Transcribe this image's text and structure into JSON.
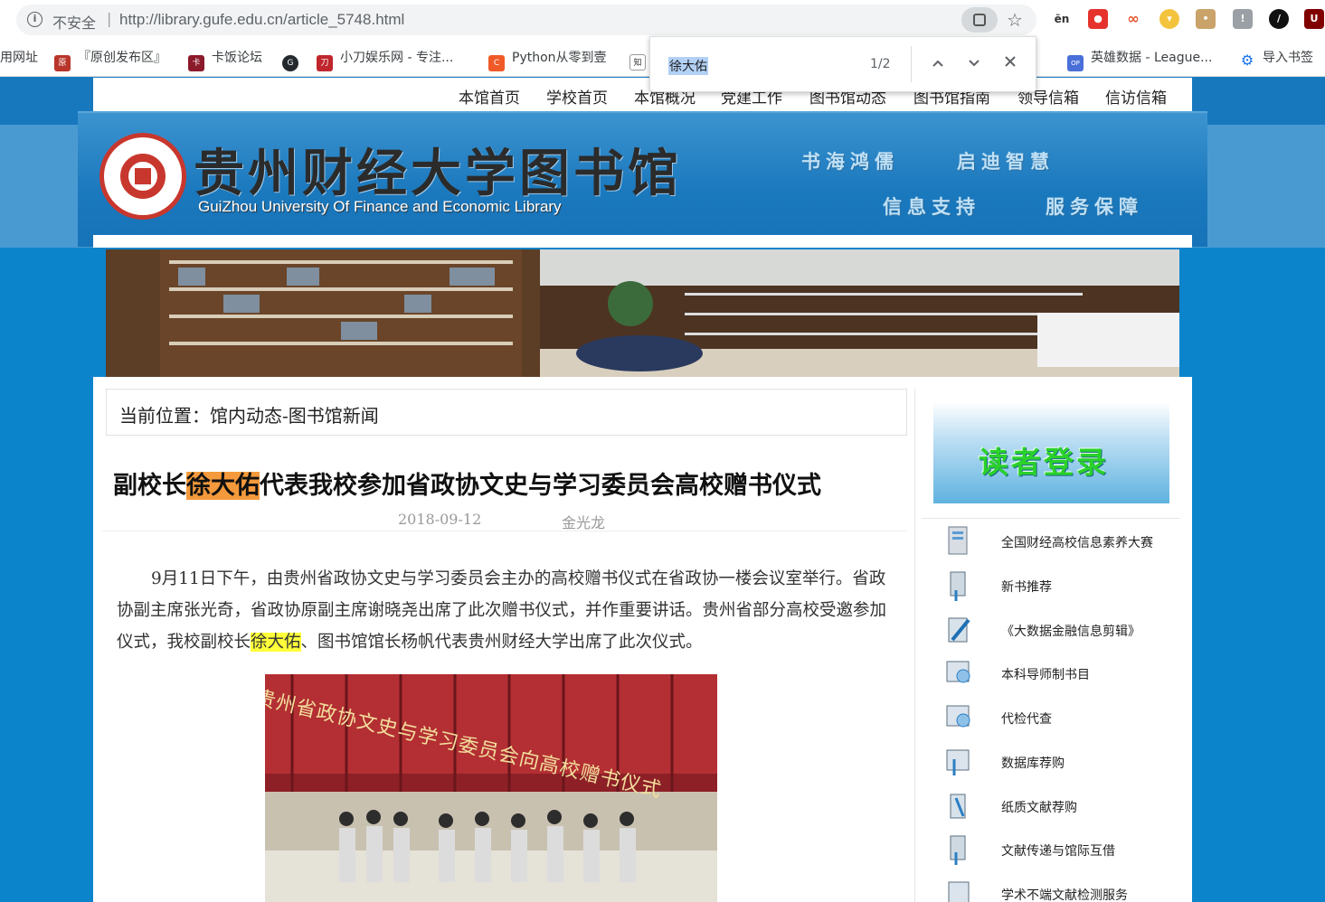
{
  "browser": {
    "security_label": "不安全",
    "url": "http://library.gufe.edu.cn/article_5748.html",
    "find": {
      "query": "徐大佑",
      "count": "1/2"
    },
    "bookmarks": [
      {
        "label": "用网址",
        "icon": "bookmark-icon"
      },
      {
        "label": "『原创发布区』",
        "icon": "site-icon"
      },
      {
        "label": "卡饭论坛",
        "icon": "kafan-icon"
      },
      {
        "label": "",
        "icon": "github-icon"
      },
      {
        "label": "小刀娱乐网 - 专注...",
        "icon": "xiaodao-icon"
      },
      {
        "label": "Python从零到壹",
        "icon": "csdn-icon"
      },
      {
        "label": "",
        "icon": "zhihu-icon"
      },
      {
        "label": "英雄数据 - League...",
        "icon": "opgg-icon"
      },
      {
        "label": "导入书签",
        "icon": "gear-icon"
      }
    ]
  },
  "site": {
    "nav": [
      "本馆首页",
      "学校首页",
      "本馆概况",
      "党建工作",
      "图书馆动态",
      "图书馆指南",
      "领导信箱",
      "信访信箱"
    ],
    "library_name": "贵州财经大学图书馆",
    "library_name_en": "GuiZhou University Of Finance and Economic Library",
    "slogans": [
      "书海鸿儒",
      "启迪智慧",
      "信息支持",
      "服务保障"
    ]
  },
  "article": {
    "breadcrumb": "当前位置：馆内动态-图书馆新闻",
    "title_before": "副校长",
    "title_highlight": "徐大佑",
    "title_after": "代表我校参加省政协文史与学习委员会高校赠书仪式",
    "date": "2018-09-12",
    "author": "金光龙",
    "body_before": "9月11日下午，由贵州省政协文史与学习委员会主办的高校赠书仪式在省政协一楼会议室举行。省政协副主席张光奇，省政协原副主席谢晓尧出席了此次赠书仪式，并作重要讲话。贵州省部分高校受邀参加仪式，我校副校长",
    "body_highlight": "徐大佑",
    "body_after": "、图书馆馆长杨帆代表贵州财经大学出席了此次仪式。",
    "photo_banner": "贵州省政协文史与学习委员会向高校赠书仪式"
  },
  "sidebar": {
    "login_label": "读者登录",
    "items": [
      {
        "label": "全国财经高校信息素养大赛",
        "icon": "document-icon"
      },
      {
        "label": "新书推荐",
        "icon": "book-icon"
      },
      {
        "label": "《大数据金融信息剪辑》",
        "icon": "pen-icon"
      },
      {
        "label": "本科导师制书目",
        "icon": "cdrom-icon"
      },
      {
        "label": "代检代查",
        "icon": "cssci-icon"
      },
      {
        "label": "数据库荐购",
        "icon": "vpn-icon"
      },
      {
        "label": "纸质文献荐购",
        "icon": "pencil-icon"
      },
      {
        "label": "文献传递与馆际互借",
        "icon": "phone-icon"
      },
      {
        "label": "学术不端文献检测服务",
        "icon": "check-icon"
      }
    ]
  }
}
